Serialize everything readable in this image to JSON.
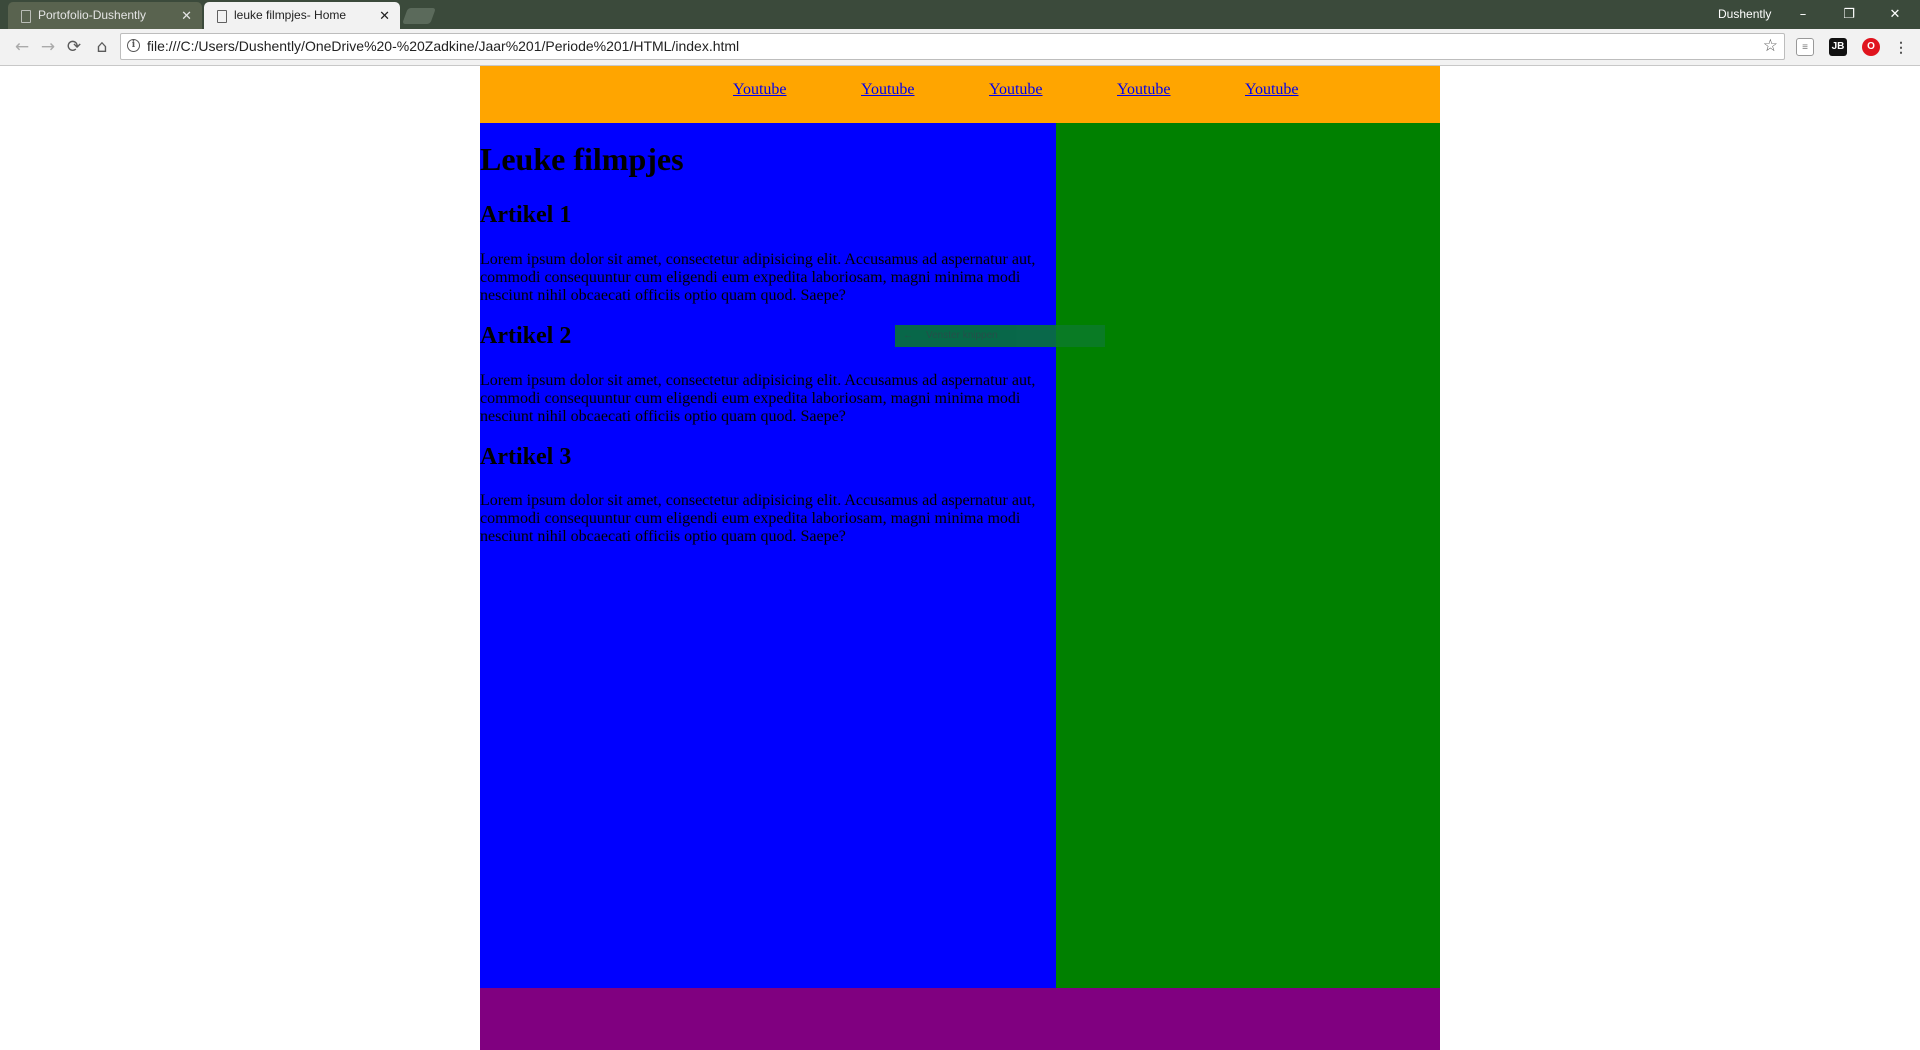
{
  "browser": {
    "tabs": [
      {
        "title": "Portofolio-Dushently",
        "active": false
      },
      {
        "title": "leuke filmpjes- Home",
        "active": true
      }
    ],
    "profile_name": "Dushently",
    "window_controls": {
      "minimize": "–",
      "restore": "❐",
      "close": "✕"
    },
    "address": "file:///C:/Users/Dushently/OneDrive%20-%20Zadkine/Jaar%201/Periode%201/HTML/index.html",
    "nav_icons": {
      "back": "back-arrow-icon",
      "forward": "forward-arrow-icon",
      "reload": "reload-icon",
      "home": "home-icon"
    },
    "extension_icons": [
      "extension-page-icon",
      "jetbrains-icon",
      "opera-icon",
      "menu-dots-icon"
    ]
  },
  "page": {
    "nav_links": [
      "Youtube",
      "Youtube",
      "Youtube",
      "Youtube",
      "Youtube"
    ],
    "heading": "Leuke filmpjes",
    "articles": [
      {
        "title": "Artikel 1",
        "body": "Lorem ipsum dolor sit amet, consectetur adipisicing elit. Accusamus ad aspernatur aut, commodi consequuntur cum eligendi eum expedita laboriosam, magni minima modi nesciunt nihil obcaecati officiis optio quam quod. Saepe?"
      },
      {
        "title": "Artikel 2",
        "body": "Lorem ipsum dolor sit amet, consectetur adipisicing elit. Accusamus ad aspernatur aut, commodi consequuntur cum eligendi eum expedita laboriosam, magni minima modi nesciunt nihil obcaecati officiis optio quam quod. Saepe?"
      },
      {
        "title": "Artikel 3",
        "body": "Lorem ipsum dolor sit amet, consectetur adipisicing elit. Accusamus ad aspernatur aut, commodi consequuntur cum eligendi eum expedita laboriosam, magni minima modi nesciunt nihil obcaecati officiis optio quam quod. Saepe?"
      }
    ],
    "tooltip": "Venster knippen",
    "colors": {
      "nav": "#ffa500",
      "main": "#0000ff",
      "aside": "#008000",
      "footer": "#800080",
      "link": "#0000ee"
    }
  }
}
